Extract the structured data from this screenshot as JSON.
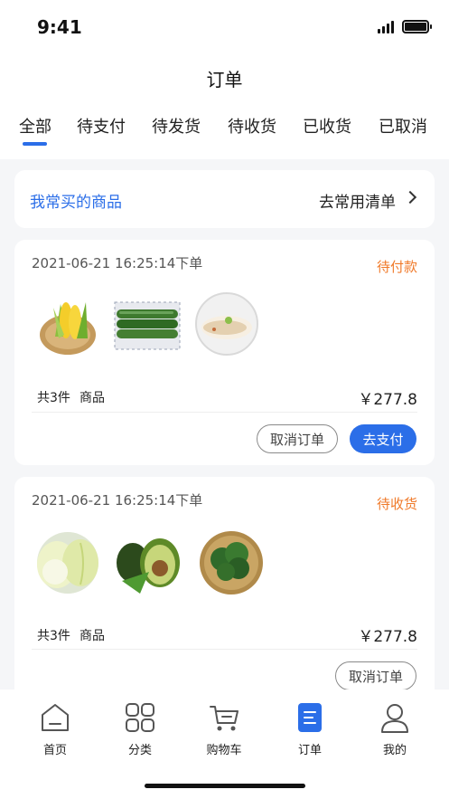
{
  "status_bar": {
    "time": "9:41"
  },
  "header": {
    "title": "订单"
  },
  "tabs": [
    {
      "label": "全部",
      "active": true
    },
    {
      "label": "待支付"
    },
    {
      "label": "待发货"
    },
    {
      "label": "待收货"
    },
    {
      "label": "已收货"
    },
    {
      "label": "已取消"
    }
  ],
  "frequent": {
    "title": "我常买的商品",
    "link_label": "去常用清单"
  },
  "orders": [
    {
      "time": "2021-06-21 16:25:14下单",
      "status": "待付款",
      "items": [
        "corn-image",
        "cucumber-image",
        "fish-image"
      ],
      "count_label": "共3件",
      "goods_label": "商品",
      "price": "￥277.8",
      "buttons": {
        "cancel": "取消订单",
        "pay": "去支付"
      }
    },
    {
      "time": "2021-06-21 16:25:14下单",
      "status": "待收货",
      "items": [
        "cabbage-image",
        "avocado-image",
        "broccoli-image"
      ],
      "count_label": "共3件",
      "goods_label": "商品",
      "price": "￥277.8",
      "buttons": {
        "cancel": "取消订单"
      }
    }
  ],
  "bottom_nav": [
    {
      "label": "首页",
      "icon": "home-icon"
    },
    {
      "label": "分类",
      "icon": "category-icon"
    },
    {
      "label": "购物车",
      "icon": "cart-icon"
    },
    {
      "label": "订单",
      "icon": "order-icon",
      "active": true
    },
    {
      "label": "我的",
      "icon": "profile-icon"
    }
  ],
  "colors": {
    "accent": "#2b6ee8",
    "status": "#f07a2a",
    "background": "#f5f6f8"
  }
}
